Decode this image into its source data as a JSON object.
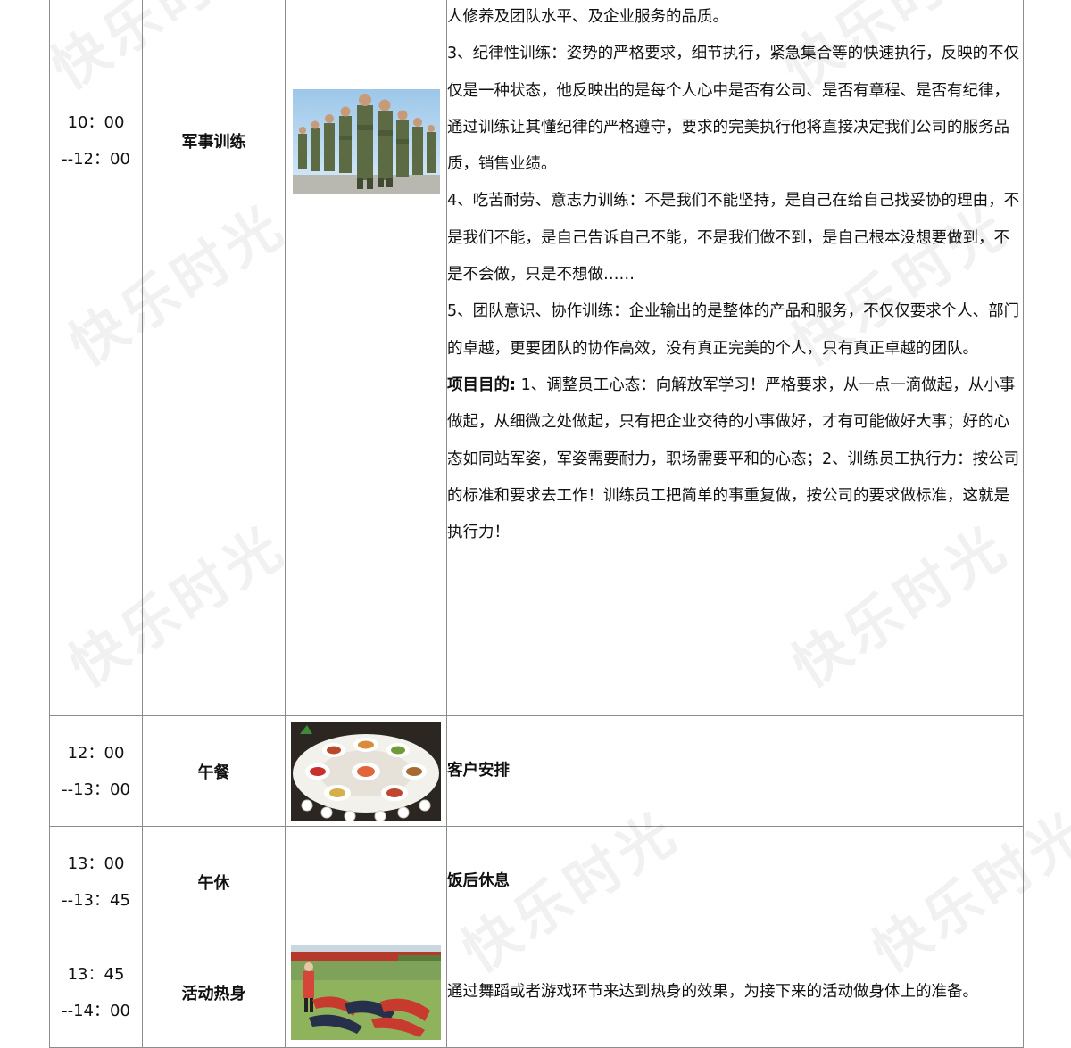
{
  "watermark": "快乐时光",
  "rows": [
    {
      "time_start": "10：00",
      "time_end": "--12：00",
      "activity": "军事训练",
      "image_icon": "soldiers-marching-photo",
      "desc_lines": [
        "人修养及团队水平、及企业服务的品质。",
        "3、纪律性训练：姿势的严格要求，细节执行，紧急集合等的快速执行，反映的不仅仅是一种状态，他反映出的是每个人心中是否有公司、是否有章程、是否有纪律，通过训练让其懂纪律的严格遵守，要求的完美执行他将直接决定我们公司的服务品质，销售业绩。",
        "4、吃苦耐劳、意志力训练：不是我们不能坚持，是自己在给自己找妥协的理由，不是我们不能，是自己告诉自己不能，不是我们做不到，是自己根本没想要做到，不是不会做，只是不想做……",
        "5、团队意识、协作训练：企业输出的是整体的产品和服务，不仅仅要求个人、部门的卓越，更要团队的协作高效，没有真正完美的个人，只有真正卓越的团队。"
      ],
      "purpose_label": "项目目的:",
      "purpose_text": " 1、调整员工心态：向解放军学习！严格要求，从一点一滴做起，从小事做起，从细微之处做起，只有把企业交待的小事做好，才有可能做好大事；好的心态如同站军姿，军姿需要耐力，职场需要平和的心态；2、训练员工执行力：按公司的标准和要求去工作！训练员工把简单的事重复做，按公司的要求做标准，这就是执行力！"
    },
    {
      "time_start": "12：00",
      "time_end": "--13：00",
      "activity": "午餐",
      "image_icon": "banquet-table-photo",
      "desc": "客户安排"
    },
    {
      "time_start": "13：00",
      "time_end": "--13：45",
      "activity": "午休",
      "desc": "饭后休息"
    },
    {
      "time_start": "13：45",
      "time_end": "--14：00",
      "activity": "活动热身",
      "image_icon": "warmup-field-photo",
      "desc": "通过舞蹈或者游戏环节来达到热身的效果，为接下来的活动做身体上的准备。"
    }
  ]
}
